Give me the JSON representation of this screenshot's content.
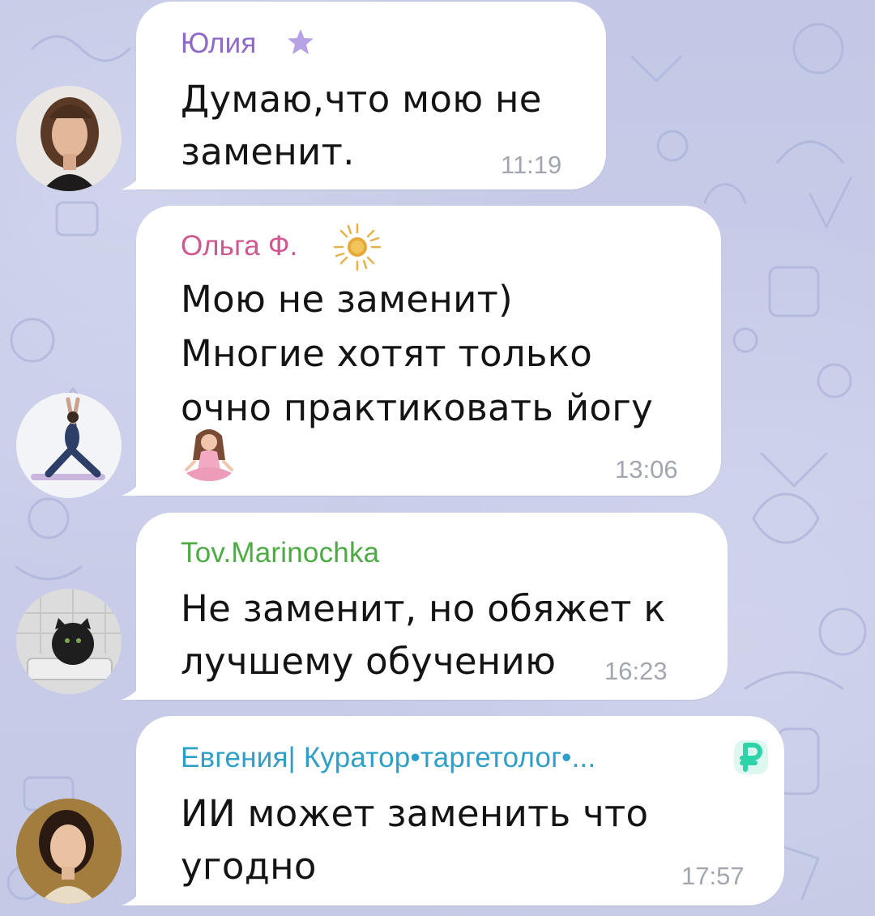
{
  "chat": {
    "messages": [
      {
        "sender": "Юлия",
        "sender_color": "#8f69c8",
        "badge_icon": "star-icon",
        "lines": [
          "Думаю,что мою не",
          "заменит."
        ],
        "time": "11:19",
        "avatar": "avatar-woman-curly-hair"
      },
      {
        "sender": "Ольга Ф.",
        "sender_color": "#d1588f",
        "badge_icon": "sun-icon",
        "lines": [
          "Мою не заменит)",
          "Многие хотят только",
          "очно практиковать йогу"
        ],
        "emoji": "yoga-meditation-icon",
        "time": "13:06",
        "avatar": "avatar-yoga-pose"
      },
      {
        "sender": "Tov.Marinochka",
        "sender_color": "#4daa44",
        "lines": [
          "Не заменит, но обяжет к",
          "лучшему обучению"
        ],
        "time": "16:23",
        "avatar": "avatar-black-cat"
      },
      {
        "sender": "Евгения| Куратор•таргетолог•...",
        "sender_color": "#2f9fc8",
        "badge_icon": "ruble-icon",
        "lines": [
          "ИИ может заменить что",
          "угодно"
        ],
        "time": "17:57",
        "avatar": "avatar-woman-dark-hair"
      }
    ]
  }
}
